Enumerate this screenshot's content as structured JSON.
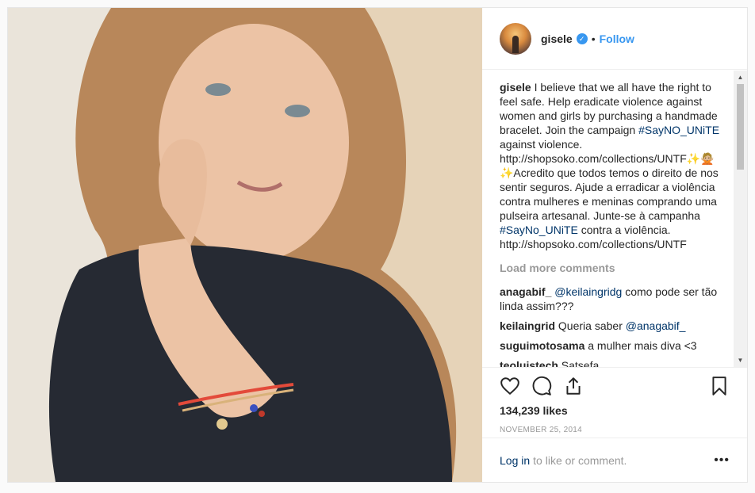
{
  "header": {
    "username": "gisele",
    "separator": "•",
    "follow_label": "Follow",
    "verified_mark": "✓"
  },
  "caption": {
    "username": "gisele",
    "text_1": "I believe that we all have the right to feel safe. Help eradicate violence against women and girls by purchasing a handmade bracelet. Join the campaign",
    "hashtag_1": "#SayNO_UNiTE",
    "text_2": "against violence. http://shopsoko.com/collections/UNTF✨🙅🏼",
    "text_3": "✨Acredito que todos temos o direito de nos sentir seguros. Ajude a erradicar a violência contra mulheres e meninas comprando uma pulseira artesanal. Junte-se à campanha",
    "hashtag_2": "#SayNo_UNiTE",
    "text_4": "contra a violência. http://shopsoko.com/collections/UNTF"
  },
  "load_more_label": "Load more comments",
  "comments": [
    {
      "user": "anagabif_",
      "mention": "@keilaingridg",
      "text": "como pode ser tão linda assim???"
    },
    {
      "user": "keilaingrid",
      "text": "Queria saber",
      "mention_after": "@anagabif_"
    },
    {
      "user": "suguimotosama",
      "text": "a mulher mais diva <3"
    },
    {
      "user": "teoluistech",
      "text": "Satsefa"
    }
  ],
  "likes": "134,239 likes",
  "date": "NOVEMBER 25, 2014",
  "login": {
    "link": "Log in",
    "rest": "to like or comment.",
    "more": "•••"
  },
  "scrollbar": {
    "up": "▲",
    "down": "▼"
  },
  "icons": [
    "heart-icon",
    "comment-icon",
    "share-icon",
    "bookmark-icon"
  ]
}
